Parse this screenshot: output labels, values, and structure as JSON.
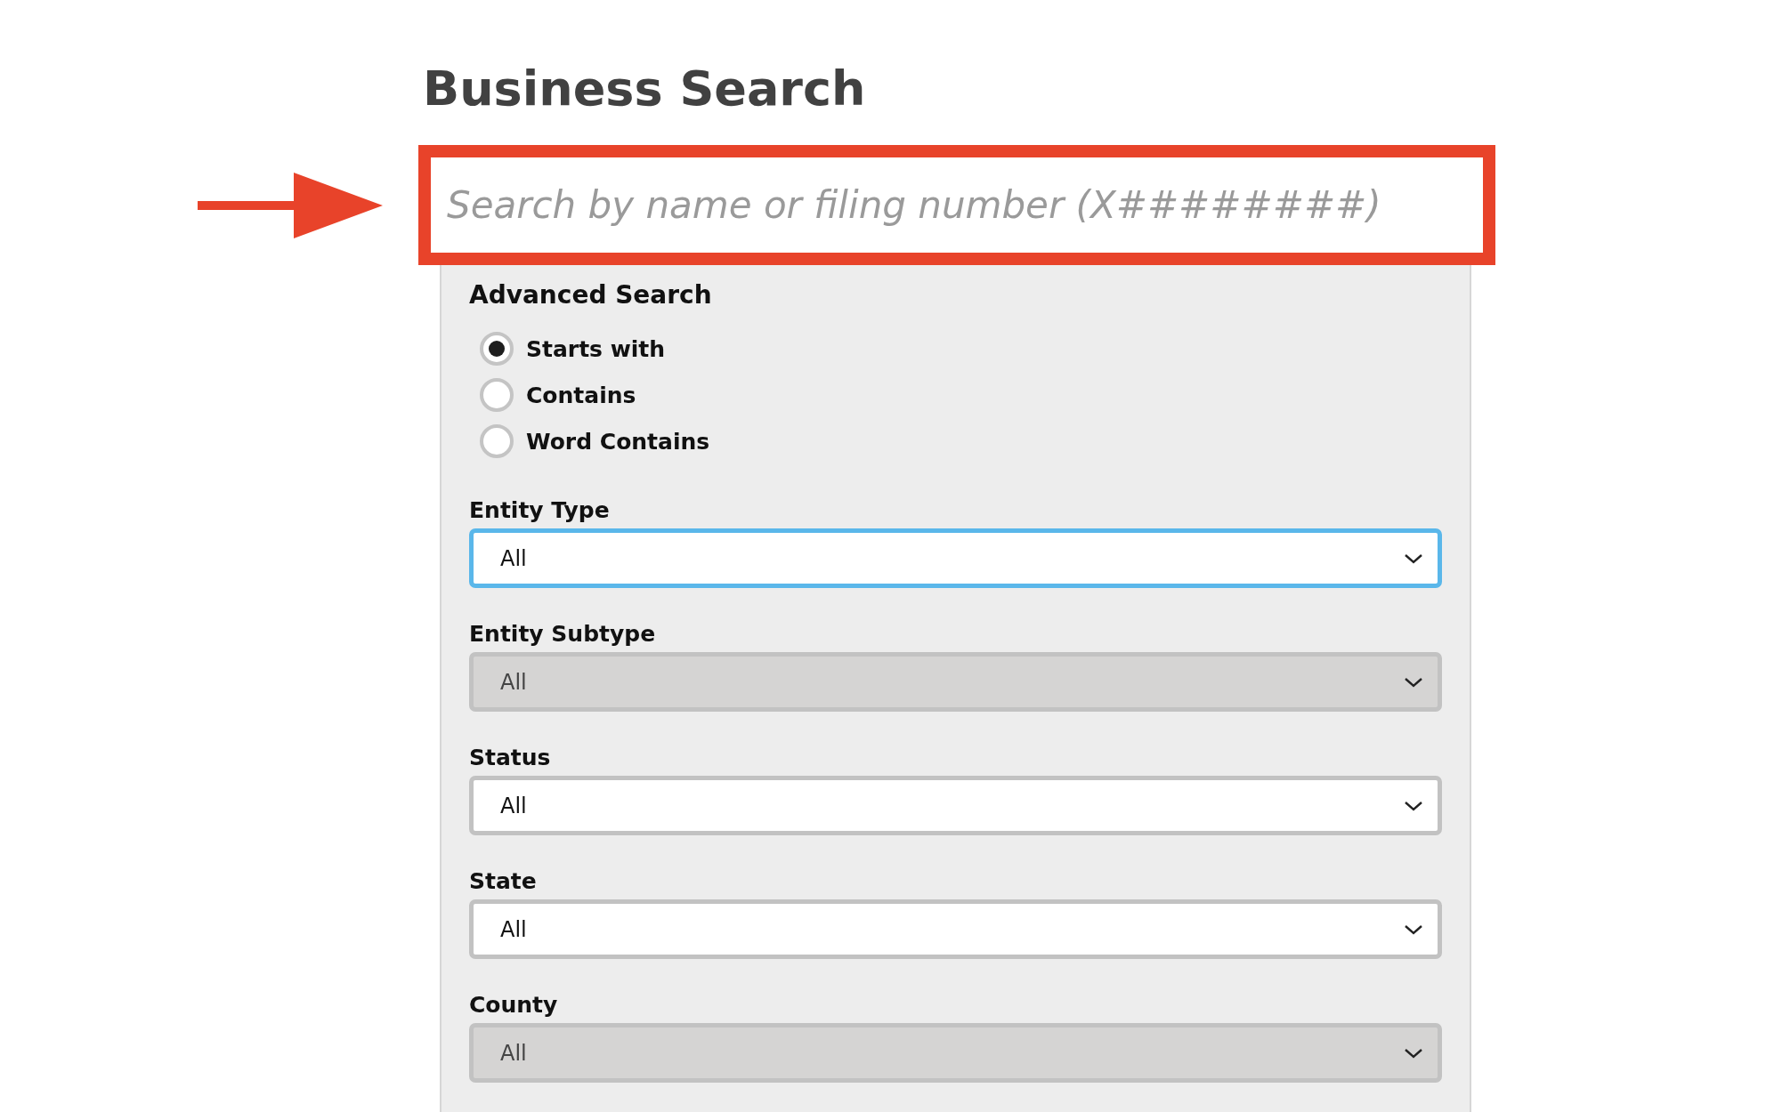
{
  "title": "Business Search",
  "search": {
    "placeholder": "Search by name or filing number (X########)",
    "highlighted": true
  },
  "advanced_search": {
    "heading": "Advanced Search",
    "match_options": [
      {
        "label": "Starts with",
        "selected": true
      },
      {
        "label": "Contains",
        "selected": false
      },
      {
        "label": "Word Contains",
        "selected": false
      }
    ],
    "filters": [
      {
        "label": "Entity Type",
        "value": "All",
        "focused": true,
        "disabled": false
      },
      {
        "label": "Entity Subtype",
        "value": "All",
        "focused": false,
        "disabled": true
      },
      {
        "label": "Status",
        "value": "All",
        "focused": false,
        "disabled": false
      },
      {
        "label": "State",
        "value": "All",
        "focused": false,
        "disabled": false
      },
      {
        "label": "County",
        "value": "All",
        "focused": false,
        "disabled": true
      }
    ]
  }
}
